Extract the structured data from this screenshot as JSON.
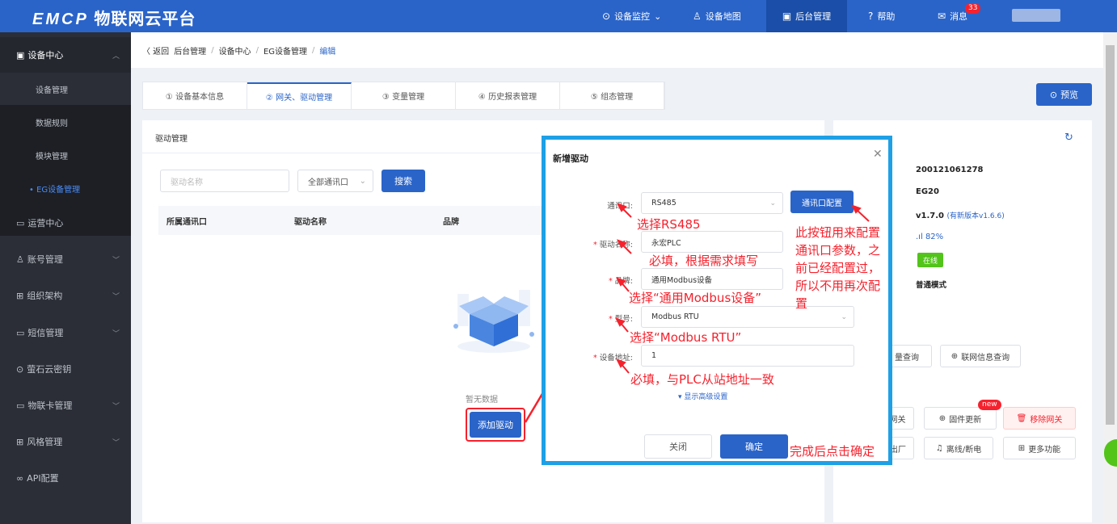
{
  "topbar": {
    "logo_brand": "EMCP",
    "logo_text": "物联网云平台",
    "nav": [
      {
        "label": "设备监控",
        "icon": "location-icon",
        "has_dropdown": true
      },
      {
        "label": "设备地图",
        "icon": "map-user-icon"
      },
      {
        "label": "后台管理",
        "icon": "monitor-icon",
        "active": true
      },
      {
        "label": "帮助",
        "icon": "help-icon"
      },
      {
        "label": "消息",
        "icon": "message-icon",
        "badge": "33"
      }
    ]
  },
  "sidebar": {
    "parent": {
      "label": "设备中心"
    },
    "children": [
      {
        "label": "设备管理"
      },
      {
        "label": "数据规则"
      },
      {
        "label": "模块管理"
      },
      {
        "label": "• EG设备管理",
        "active": true
      }
    ],
    "items": [
      {
        "label": "运营中心",
        "has_chevron": false
      },
      {
        "label": "账号管理",
        "has_chevron": true
      },
      {
        "label": "组织架构",
        "has_chevron": true
      },
      {
        "label": "短信管理",
        "has_chevron": true
      },
      {
        "label": "萤石云密钥",
        "has_chevron": false
      },
      {
        "label": "物联卡管理",
        "has_chevron": true
      },
      {
        "label": "风格管理",
        "has_chevron": true
      },
      {
        "label": "API配置",
        "has_chevron": false
      }
    ]
  },
  "breadcrumb": {
    "back": "〈 返回",
    "items": [
      "后台管理",
      "设备中心",
      "EG设备管理"
    ],
    "current": "编辑",
    "separator": "/"
  },
  "tabs": [
    {
      "label": "① 设备基本信息"
    },
    {
      "label": "② 网关、驱动管理",
      "active": true
    },
    {
      "label": "③ 变量管理"
    },
    {
      "label": "④ 历史报表管理"
    },
    {
      "label": "⑤ 组态管理"
    }
  ],
  "preview_button": "预览",
  "driver_panel": {
    "title": "驱动管理",
    "search_placeholder": "驱动名称",
    "port_select": "全部通讯口",
    "search_button": "搜索",
    "columns": [
      "所属通讯口",
      "驱动名称",
      "品牌"
    ],
    "empty_text": "暂无数据",
    "add_button": "添加驱动"
  },
  "gateway_panel": {
    "serial": "200121061278",
    "model": "EG20",
    "version": "v1.7.0",
    "update_hint": "(有新版本v1.6.6)",
    "signal": "82%",
    "status": "在线",
    "mode": "普通模式",
    "btn_flow": "流量查询",
    "btn_flow_visible": "量查询",
    "btn_network": "联网信息查询",
    "btn_gateway_visible": "网关",
    "btn_firmware": "固件更新",
    "new_badge": "new",
    "btn_remove": "移除网关",
    "btn_factory_visible": "出厂",
    "btn_offline": "离线/断电",
    "btn_more": "更多功能"
  },
  "dialog": {
    "title": "新增驱动",
    "fields": [
      {
        "label": "通讯口:",
        "required": false,
        "value": "RS485",
        "dropdown": true
      },
      {
        "label": "驱动名称:",
        "required": true,
        "value": "永宏PLC"
      },
      {
        "label": "品牌:",
        "required": true,
        "value": "通用Modbus设备"
      },
      {
        "label": "型号:",
        "required": true,
        "value": "Modbus RTU",
        "dropdown": true
      },
      {
        "label": "设备地址:",
        "required": true,
        "value": "1"
      }
    ],
    "port_config_button": "通讯口配置",
    "advanced_link": "▾ 显示高级设置",
    "cancel": "关闭",
    "confirm": "确定"
  },
  "annotations": {
    "a1": "选择RS485",
    "a2": "必填，根据需求填写",
    "a3": "选择“通用Modbus设备”",
    "a4": "选择“Modbus RTU”",
    "a5": "必填，与PLC从站地址一致",
    "a6_lines": [
      "此按钮用来配置",
      "通讯口参数，之",
      "前已经配置过，",
      "所以不用再次配",
      "置"
    ],
    "a7": "完成后点击确定"
  },
  "colors": {
    "primary": "#2a64c9",
    "sidebar": "#2b2e36",
    "annotation": "#f5222d",
    "highlight_border": "#1ea0e6",
    "online": "#52c41a"
  }
}
